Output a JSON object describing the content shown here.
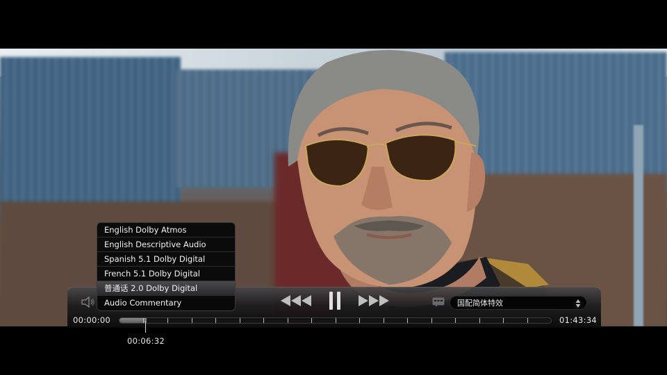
{
  "player": {
    "elapsed_time": "00:00:00",
    "total_time": "01:43:34",
    "hover_time": "00:06:32",
    "progress_fraction": 0.062
  },
  "audio_menu": {
    "items": [
      {
        "label": "English Dolby Atmos"
      },
      {
        "label": "English Descriptive Audio"
      },
      {
        "label": "Spanish 5.1 Dolby Digital"
      },
      {
        "label": "French 5.1 Dolby Digital"
      },
      {
        "label": "普通话 2.0 Dolby Digital"
      },
      {
        "label": "Audio Commentary"
      }
    ],
    "highlighted_index": 4
  },
  "subtitles": {
    "selected_value": "国配简体特效"
  },
  "controls": {
    "rewind_icon": "rewind-icon",
    "pause_icon": "pause-icon",
    "forward_icon": "fast-forward-icon",
    "volume_icon": "speaker-icon",
    "subtitle_icon": "subtitle-icon"
  },
  "colors": {
    "controller_bg": "#1c1c1e",
    "menu_bg": "#080809",
    "text": "#f2f2f2",
    "highlight": "#3a3a3c"
  }
}
